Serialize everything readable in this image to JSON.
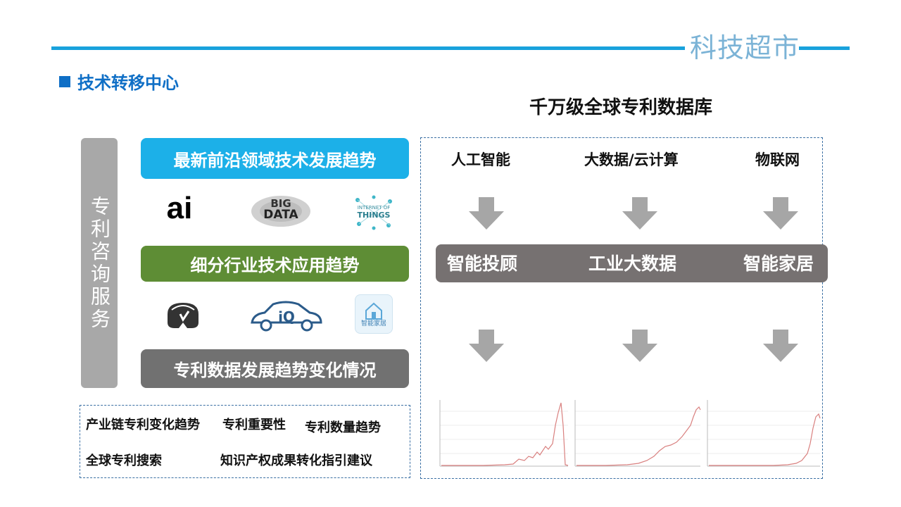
{
  "header": {
    "brand": "科技超市",
    "section_title": "技术转移中心",
    "database_title": "千万级全球专利数据库"
  },
  "left": {
    "vertical_label": "专利咨询服务",
    "bands": [
      "最新前沿领域技术发展趋势",
      "细分行业技术应用趋势",
      "专利数据发展趋势变化情况"
    ],
    "logos_row1": [
      "ai",
      "BIG",
      "DATA",
      "INTERNET OF",
      "THINGS"
    ],
    "logos_row2": [
      "iQ",
      "智能家居"
    ],
    "services": [
      "产业链专利变化趋势",
      "专利重要性",
      "专利数量趋势",
      "全球专利搜索",
      "知识产权成果转化指引建议"
    ]
  },
  "right": {
    "columns": [
      "人工智能",
      "大数据/云计算",
      "物联网"
    ],
    "applications": [
      "智能投顾",
      "工业大数据",
      "智能家居"
    ]
  },
  "colors": {
    "accent_blue": "#19a2dc",
    "title_blue": "#0f6fc6",
    "band_cyan": "#1cb0e8",
    "band_green": "#5e8d35",
    "band_grey": "#717171",
    "chart_line": "#d9807f"
  }
}
